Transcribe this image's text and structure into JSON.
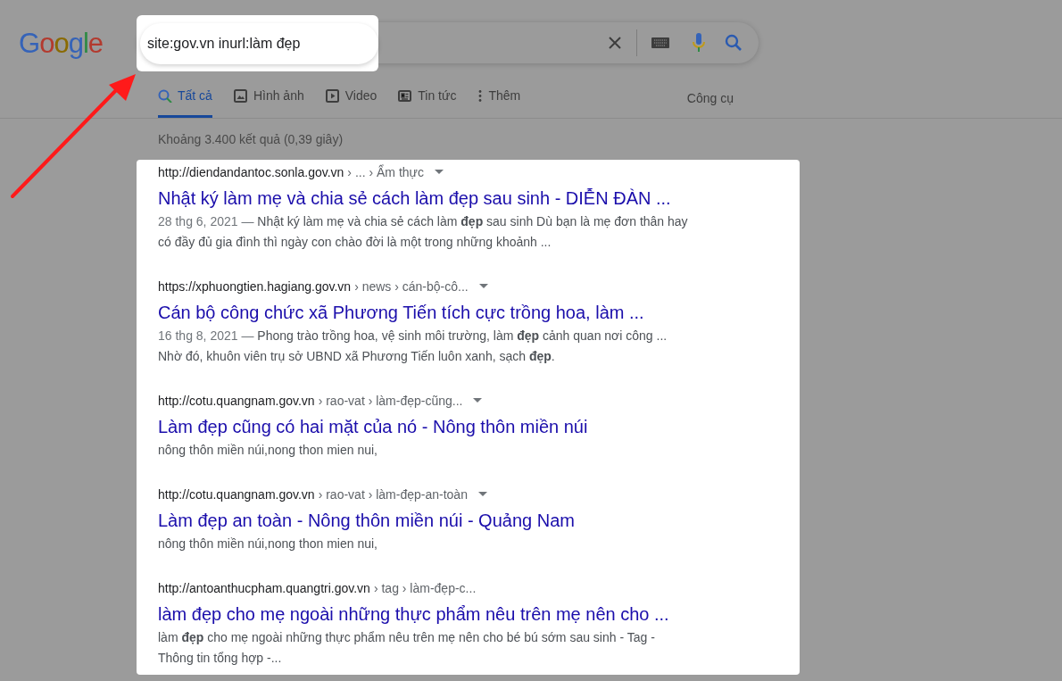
{
  "logo": {
    "text": "Google"
  },
  "search": {
    "value": "site:gov.vn inurl:làm đẹp",
    "highlighted": true
  },
  "tabs": [
    {
      "label": "Tất cả",
      "kind": "search",
      "selected": true
    },
    {
      "label": "Hình ảnh",
      "kind": "image",
      "selected": false
    },
    {
      "label": "Video",
      "kind": "video",
      "selected": false
    },
    {
      "label": "Tin tức",
      "kind": "news",
      "selected": false
    },
    {
      "label": "Thêm",
      "kind": "more",
      "selected": false
    }
  ],
  "tools": "Công cụ",
  "result_stats": "Khoảng 3.400 kết quả (0,39 giây)",
  "results": [
    {
      "domain": "http://diendandantoc.sonla.gov.vn",
      "path": "› ... › Ẩm thực",
      "menu": true,
      "title": "Nhật ký làm mẹ và chia sẻ cách làm đẹp sau sinh - DIỄN ĐÀN ...",
      "date": "28 thg 6, 2021 —",
      "snippet": "Nhật ký làm mẹ và chia sẻ cách làm **đẹp** sau sinh Dù bạn là mẹ đơn thân hay có đầy đủ gia đình thì ngày con chào đời là một trong những khoảnh ..."
    },
    {
      "domain": "https://xphuongtien.hagiang.gov.vn",
      "path": "› news › cán-bộ-cô...",
      "menu": true,
      "title": "Cán bộ công chức xã Phương Tiến tích cực trồng hoa, làm ...",
      "date": "16 thg 8, 2021 —",
      "snippet": "Phong trào trồng hoa, vệ sinh môi trường, làm **đẹp** cảnh quan nơi công ... Nhờ đó, khuôn viên trụ sở UBND xã Phương Tiến luôn xanh, sạch **đẹp**."
    },
    {
      "domain": "http://cotu.quangnam.gov.vn",
      "path": "› rao-vat › làm-đẹp-cũng...",
      "menu": true,
      "title": "Làm đẹp cũng có hai mặt của nó - Nông thôn miền núi",
      "snippet": "nông thôn miền núi,nong thon mien nui,"
    },
    {
      "domain": "http://cotu.quangnam.gov.vn",
      "path": "› rao-vat › làm-đẹp-an-toàn",
      "menu": true,
      "title": "Làm đẹp an toàn - Nông thôn miền núi - Quảng Nam",
      "snippet": "nông thôn miền núi,nong thon mien nui,"
    },
    {
      "domain": "http://antoanthucpham.quangtri.gov.vn",
      "path": "› tag › làm-đẹp-c...",
      "menu": false,
      "title": "làm đẹp cho mẹ ngoài những thực phẩm nêu trên mẹ nên cho ...",
      "snippet": "làm **đẹp** cho mẹ ngoài những thực phẩm nêu trên mẹ nên cho bé bú sớm sau sinh - Tag - Thông tin tổng hợp -..."
    }
  ],
  "annotation": {
    "kind": "arrow",
    "color": "#ff1a1a"
  }
}
